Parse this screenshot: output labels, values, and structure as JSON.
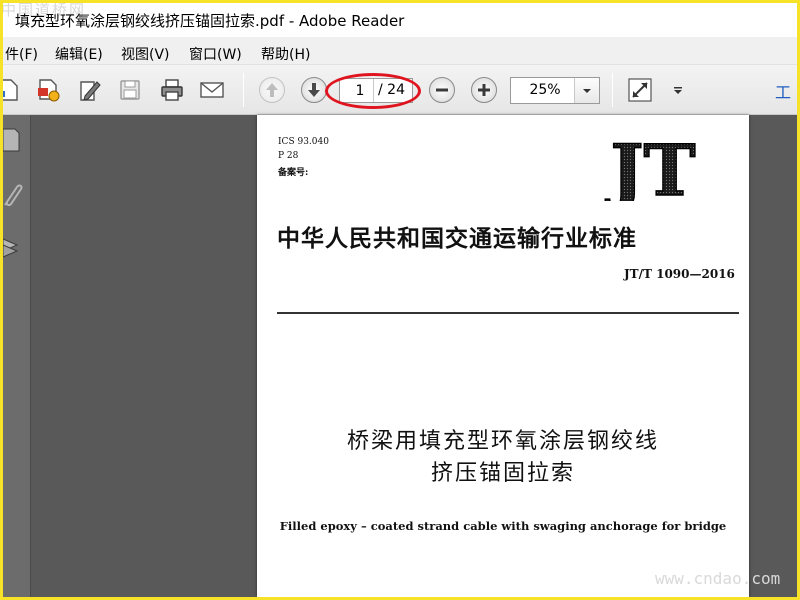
{
  "app": {
    "window_title": "填充型环氧涂层钢绞线挤压锚固拉索.pdf - Adobe Reader"
  },
  "watermarks": {
    "top_left": "中国道桥网",
    "bottom_right": "www.cndao.com"
  },
  "menu": {
    "items": [
      {
        "label": "件(F)"
      },
      {
        "label": "编辑(E)"
      },
      {
        "label": "视图(V)"
      },
      {
        "label": "窗口(W)"
      },
      {
        "label": "帮助(H)"
      }
    ]
  },
  "toolbar": {
    "current_page": "1",
    "total_pages": "/ 24",
    "zoom": "25%",
    "right_label": "工"
  },
  "colors": {
    "highlight_ellipse": "#e0141e",
    "frame_border": "#f7e22a",
    "document_background": "#595959"
  },
  "document": {
    "ics": "ICS 93.040",
    "p_code": "P 28",
    "record_label": "备案号:",
    "logo_text": "JT",
    "standard_title_cn": "中华人民共和国交通运输行业标准",
    "standard_code": "JT/T 1090—2016",
    "main_title_line1": "桥梁用填充型环氧涂层钢绞线",
    "main_title_line2": "挤压锚固拉索",
    "english_title": "Filled epoxy – coated strand cable with swaging anchorage for bridge"
  }
}
